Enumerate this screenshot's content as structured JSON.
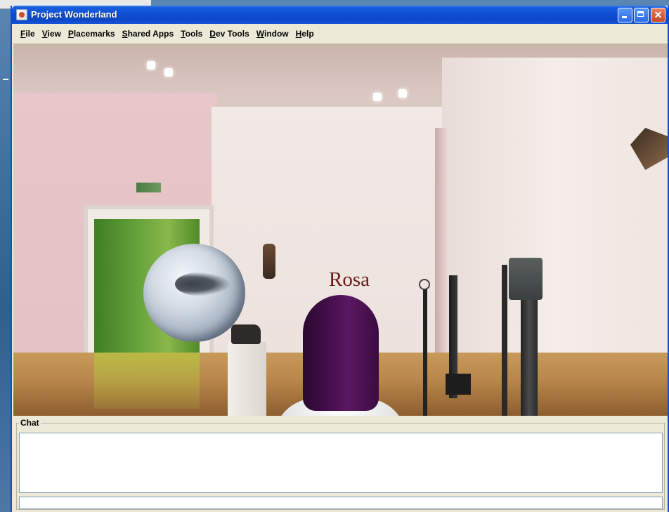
{
  "window": {
    "title": "Project Wonderland",
    "controls": {
      "minimize_icon": "minimize-icon",
      "maximize_icon": "maximize-icon",
      "close_icon": "close-icon"
    }
  },
  "menubar": {
    "items": [
      {
        "mnemonic": "F",
        "rest": "ile"
      },
      {
        "mnemonic": "V",
        "rest": "iew"
      },
      {
        "mnemonic": "P",
        "rest": "lacemarks"
      },
      {
        "mnemonic": "S",
        "rest": "hared Apps"
      },
      {
        "mnemonic": "T",
        "rest": "ools"
      },
      {
        "mnemonic": "D",
        "rest": "ev Tools"
      },
      {
        "mnemonic": "W",
        "rest": "indow"
      },
      {
        "mnemonic": "H",
        "rest": "elp"
      }
    ]
  },
  "scene": {
    "avatar_name": "Rosa"
  },
  "chat": {
    "label": "Chat",
    "log": "",
    "input_value": ""
  },
  "colors": {
    "titlebar": "#0f4fd2",
    "avatar_name": "#6b1a14",
    "avatar_head": "#4a0f50"
  }
}
